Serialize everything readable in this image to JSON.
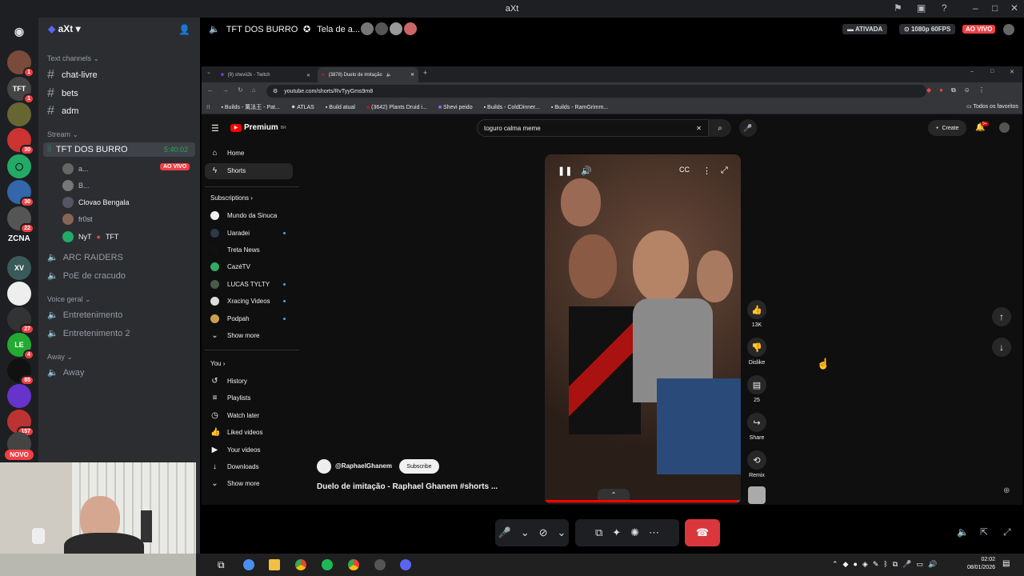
{
  "window": {
    "title": "aXt"
  },
  "discord": {
    "server_name": "aXt",
    "rail_label": "ZCNA",
    "rail_badges": [
      "1",
      "1",
      "30",
      "30",
      "22",
      "27",
      "4",
      "85",
      "157"
    ],
    "novo": "NOVO",
    "categories": {
      "text": "Text channels",
      "stream": "Stream",
      "voice": "Voice geral",
      "away": "Away"
    },
    "text_channels": [
      "chat-livre",
      "bets",
      "adm"
    ],
    "stream_channel": {
      "name": "TFT DOS BURRO",
      "timer": "5:40:02"
    },
    "members": [
      {
        "name": "a...",
        "live": "AO VIVO"
      },
      {
        "name": "B..."
      },
      {
        "name": "Clovao Bengala"
      },
      {
        "name": "fr0st"
      },
      {
        "name": "NyT",
        "game": "TFT"
      }
    ],
    "other_stream_channels": [
      "ARC RAIDERS",
      "PoE de cracudo"
    ],
    "voice_channels": [
      "Entretenimento",
      "Entretenimento 2"
    ],
    "away_channels": [
      "Away"
    ]
  },
  "stream_header": {
    "channel": "TFT DOS BURRO",
    "screen_label": "Tela de a...",
    "activated": "ATIVADA",
    "quality": "1080p 60FPS",
    "live": "AO VIVO"
  },
  "browser": {
    "tabs": [
      "(9) shevii2k - Twitch",
      "(3878) Duelo de imitação"
    ],
    "url": "youtube.com/shorts/RvTyyGms9m8",
    "bookmarks": [
      "Builds - 萬法王 - Pat...",
      "ATLAS",
      "Build atual",
      "(3642) Plants Druid i...",
      "Shevi peido",
      "Builds - ColdDinner...",
      "Builds - RamGrimm..."
    ],
    "all_bookmarks": "Todos os favoritos"
  },
  "youtube": {
    "logo": "Premium",
    "logo_sup": "BR",
    "search_value": "toguro calma meme",
    "create_label": "Create",
    "notif_count": "9+",
    "nav": [
      "Home",
      "Shorts"
    ],
    "subscriptions_label": "Subscriptions",
    "subscriptions": [
      "Mundo da Sinuca",
      "Uaradei",
      "Treta News",
      "CazéTV",
      "LUCAS TYLTY",
      "Xracing Videos",
      "Podpah"
    ],
    "show_more": "Show more",
    "you_label": "You",
    "you_items": [
      "History",
      "Playlists",
      "Watch later",
      "Liked videos",
      "Your videos",
      "Downloads"
    ],
    "show_more_2": "Show more",
    "channel_handle": "@RaphaelGhanem",
    "subscribe": "Subscribe",
    "video_title": "Duelo de imitação - Raphael Ghanem #shorts ...",
    "actions": {
      "likes": "13K",
      "dislike": "Dislike",
      "comments": "25",
      "share": "Share",
      "remix": "Remix"
    }
  },
  "taskbar": {
    "time": "02:02",
    "date": "08/01/2026"
  }
}
